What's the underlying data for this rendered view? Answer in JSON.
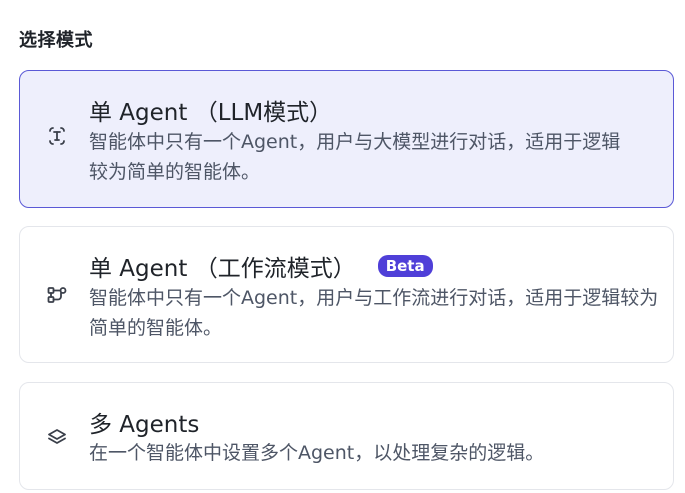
{
  "section_title": "选择模式",
  "options": [
    {
      "title": "单 Agent （LLM模式）",
      "description": "智能体中只有一个Agent，用户与大模型进行对话，适用于逻辑较为简单的智能体。",
      "icon": "single-agent-icon",
      "selected": true
    },
    {
      "title": "单 Agent （工作流模式）",
      "badge": "Beta",
      "description": "智能体中只有一个Agent，用户与工作流进行对话，适用于逻辑较为简单的智能体。",
      "icon": "workflow-icon",
      "selected": false
    },
    {
      "title": "多 Agents",
      "description": "在一个智能体中设置多个Agent，以处理复杂的逻辑。",
      "icon": "layers-icon",
      "selected": false
    }
  ],
  "colors": {
    "accent": "#5a59d6",
    "selected_bg": "#eeeffc",
    "badge_bg": "#4f3fd8"
  }
}
